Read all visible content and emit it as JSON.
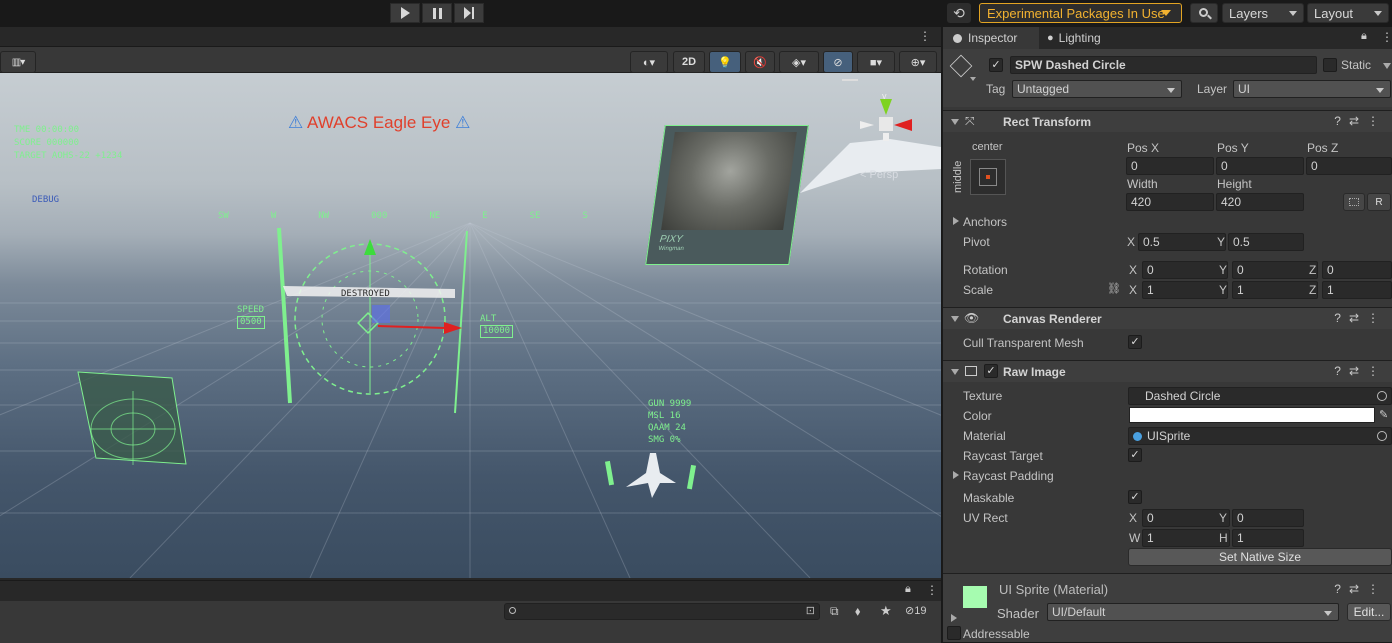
{
  "toolbar": {
    "experimental_label": "Experimental Packages In Use",
    "layers_label": "Layers",
    "layout_label": "Layout"
  },
  "scene": {
    "hud_title": "AWACS Eagle Eye",
    "debug_label": "DEBUG",
    "status_lines": [
      "TME 00:00:00",
      "SCORE 000000",
      "TARGET AOHS-22 +1234"
    ],
    "compass": [
      "SW",
      "W",
      "NW",
      "000",
      "NE",
      "E",
      "SE",
      "S"
    ],
    "destroyed_label": "DESTROYED",
    "speed_label": "SPEED",
    "speed_value": "0500",
    "alt_label": "ALT",
    "alt_value": "10000",
    "weapons": [
      "GUN   9999",
      "MSL   16",
      "QAAM  24",
      "SMG   0%"
    ],
    "pilot_name": "PIXY",
    "pilot_sub": "Wingman",
    "persp_label": "< Persp",
    "gizmo_y": "y",
    "view_2d": "2D",
    "hidden_count": "19"
  },
  "inspector": {
    "tabs": [
      {
        "label": "Inspector"
      },
      {
        "label": "Lighting"
      }
    ],
    "object_name": "SPW Dashed Circle",
    "static_label": "Static",
    "tag_label": "Tag",
    "tag_value": "Untagged",
    "layer_label": "Layer",
    "layer_value": "UI",
    "rect_transform": {
      "title": "Rect Transform",
      "anchor_h": "center",
      "anchor_v": "middle",
      "pos_x_label": "Pos X",
      "pos_x": "0",
      "pos_y_label": "Pos Y",
      "pos_y": "0",
      "pos_z_label": "Pos Z",
      "pos_z": "0",
      "width_label": "Width",
      "width": "420",
      "height_label": "Height",
      "height": "420",
      "r_label": "R",
      "anchors_label": "Anchors",
      "pivot_label": "Pivot",
      "pivot_x": "0.5",
      "pivot_y": "0.5",
      "rotation_label": "Rotation",
      "rot_x": "0",
      "rot_y": "0",
      "rot_z": "0",
      "scale_label": "Scale",
      "scale_x": "1",
      "scale_y": "1",
      "scale_z": "1",
      "x": "X",
      "y": "Y",
      "z": "Z"
    },
    "canvas_renderer": {
      "title": "Canvas Renderer",
      "cull_label": "Cull Transparent Mesh"
    },
    "raw_image": {
      "title": "Raw Image",
      "texture_label": "Texture",
      "texture_value": "Dashed Circle",
      "color_label": "Color",
      "material_label": "Material",
      "material_value": "UISprite",
      "raycast_target_label": "Raycast Target",
      "raycast_padding_label": "Raycast Padding",
      "maskable_label": "Maskable",
      "uvrect_label": "UV Rect",
      "uv_x": "0",
      "uv_y": "0",
      "uv_w": "1",
      "uv_h": "1",
      "w": "W",
      "h": "H",
      "native_size_label": "Set Native Size"
    },
    "material": {
      "title": "UI Sprite (Material)",
      "shader_label": "Shader",
      "shader_value": "UI/Default",
      "edit_label": "Edit..."
    },
    "addressable_label": "Addressable"
  },
  "colors": {
    "accent": "#f2b230",
    "hud_green": "#7ff08e",
    "hud_title": "#e0402c",
    "material_swatch": "#a6fcb0"
  }
}
